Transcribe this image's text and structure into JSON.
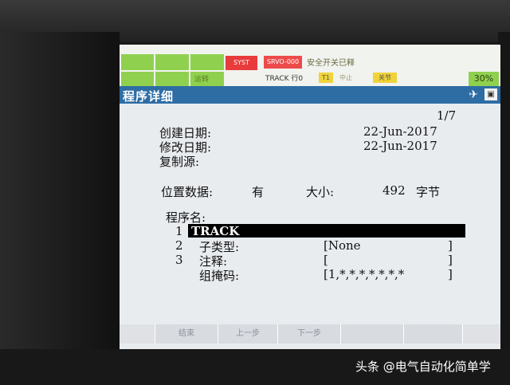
{
  "status": {
    "emergency_button": "SYST",
    "alarm_code": "SRVO-000",
    "alarm_text": "安全开关已释",
    "program_line": "TRACK 行0",
    "mode_indicator": "T1",
    "stop_label": "中止",
    "coord_indicator": "关节",
    "override": "30%",
    "led_label": "运转"
  },
  "screen_title": "程序详细",
  "page_indicator": "1/7",
  "created_label": "创建日期:",
  "created_value": "22-Jun-2017",
  "modified_label": "修改日期:",
  "modified_value": "22-Jun-2017",
  "copy_source_label": "复制源:",
  "position_data_label": "位置数据:",
  "position_data_value": "有",
  "size_label": "大小:",
  "size_value": "492",
  "size_unit": "字节",
  "program_name_label": "程序名:",
  "rows": [
    {
      "num": "1",
      "label": "",
      "value": "TRACK"
    },
    {
      "num": "2",
      "label": "子类型:",
      "value": "[None"
    },
    {
      "num": "3",
      "label": "注释:",
      "value": "[",
      "close": "]"
    },
    {
      "num": "",
      "label": "组掩码:",
      "value": "[1,*,*,*,*,*,*,*",
      "close": "]"
    }
  ],
  "type_bracket_close": "]",
  "function_keys": [
    "",
    "结束",
    "上一步",
    "下一步",
    "",
    ""
  ],
  "watermark": "头条 @电气自动化简单学",
  "colors": {
    "title_bar": "#2e6da4",
    "led_green": "#8fd14f",
    "alarm_red": "#e83b3b",
    "indicator_yellow": "#f0d33a"
  }
}
